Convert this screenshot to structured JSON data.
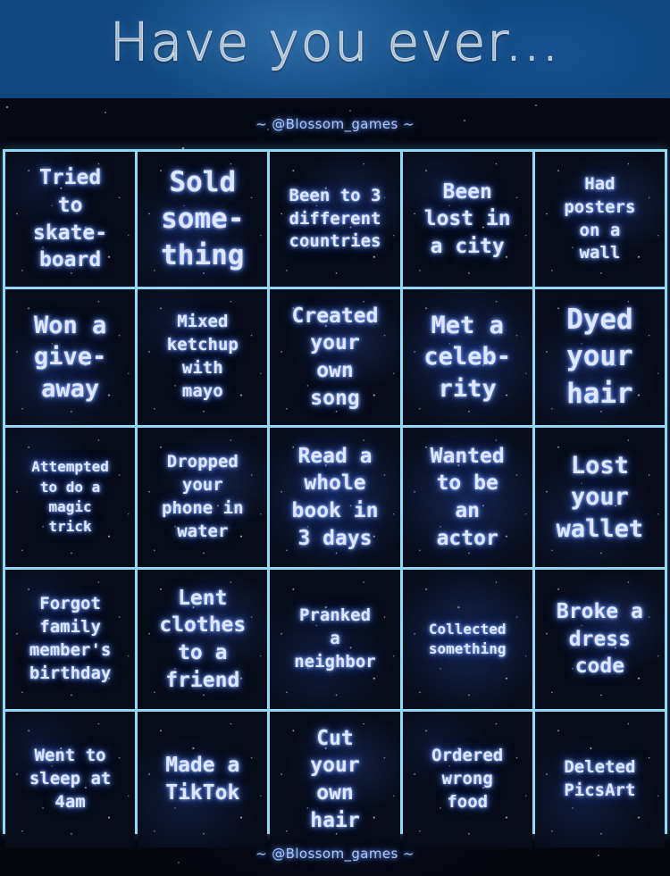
{
  "header": {
    "title": "Have you ever...",
    "band_color": "#10477f"
  },
  "watermark": {
    "top": "~ @Blossom_games ~",
    "bottom": "~ @Blossom_games ~"
  },
  "colors": {
    "grid_border": "#8fd8f6",
    "cell_background": "#070c18",
    "text": "#dfe7ff",
    "glow": "#5f8cff",
    "watermark": "#a9c8ff"
  },
  "grid": {
    "rows": 5,
    "columns": 5,
    "cells": [
      {
        "text": "Tried\nto\nskate-\nboard",
        "size": "md",
        "neb": "neb-d"
      },
      {
        "text": "Sold\nsome-\nthing",
        "size": "xl",
        "neb": "neb-b"
      },
      {
        "text": "Been to 3\ndifferent\ncountries",
        "size": "sm",
        "neb": "neb-a"
      },
      {
        "text": "Been\nlost in\na city",
        "size": "md",
        "neb": "neb-d"
      },
      {
        "text": "Had\nposters\non a\nwall",
        "size": "sm",
        "neb": "neb-a"
      },
      {
        "text": "Won a\ngive-\naway",
        "size": "lg",
        "neb": "neb-b"
      },
      {
        "text": "Mixed\nketchup\nwith\nmayo",
        "size": "sm",
        "neb": "neb-d"
      },
      {
        "text": "Created\nyour\nown\nsong",
        "size": "md",
        "neb": "neb-a"
      },
      {
        "text": "Met a\nceleb-\nrity",
        "size": "lg",
        "neb": "neb-c"
      },
      {
        "text": "Dyed\nyour\nhair",
        "size": "xl",
        "neb": "neb-b"
      },
      {
        "text": "Attempted\nto do a\nmagic\ntrick",
        "size": "xs",
        "neb": "neb-d"
      },
      {
        "text": "Dropped\nyour\nphone in\nwater",
        "size": "sm",
        "neb": "neb-a"
      },
      {
        "text": "Read a\nwhole\nbook in\n3 days",
        "size": "md",
        "neb": "neb-c"
      },
      {
        "text": "Wanted\nto be\nan\nactor",
        "size": "md",
        "neb": "neb-c"
      },
      {
        "text": "Lost\nyour\nwallet",
        "size": "lg",
        "neb": "neb-b"
      },
      {
        "text": "Forgot\nfamily\nmember's\nbirthday",
        "size": "sm",
        "neb": "neb-d"
      },
      {
        "text": "Lent\nclothes\nto a\nfriend",
        "size": "md",
        "neb": "neb-a"
      },
      {
        "text": "Pranked\na\nneighbor",
        "size": "sm",
        "neb": "neb-b"
      },
      {
        "text": "Collected\nsomething",
        "size": "xs",
        "neb": "neb-c"
      },
      {
        "text": "Broke a\ndress\ncode",
        "size": "md",
        "neb": "neb-a"
      },
      {
        "text": "Went to\nsleep at\n4am",
        "size": "sm",
        "neb": "neb-d"
      },
      {
        "text": "Made a\nTikTok",
        "size": "md",
        "neb": "neb-b"
      },
      {
        "text": "Cut\nyour\nown\nhair",
        "size": "md",
        "neb": "neb-a"
      },
      {
        "text": "Ordered\nwrong\nfood",
        "size": "sm",
        "neb": "neb-d"
      },
      {
        "text": "Deleted\nPicsArt",
        "size": "sm",
        "neb": "neb-b"
      }
    ]
  }
}
